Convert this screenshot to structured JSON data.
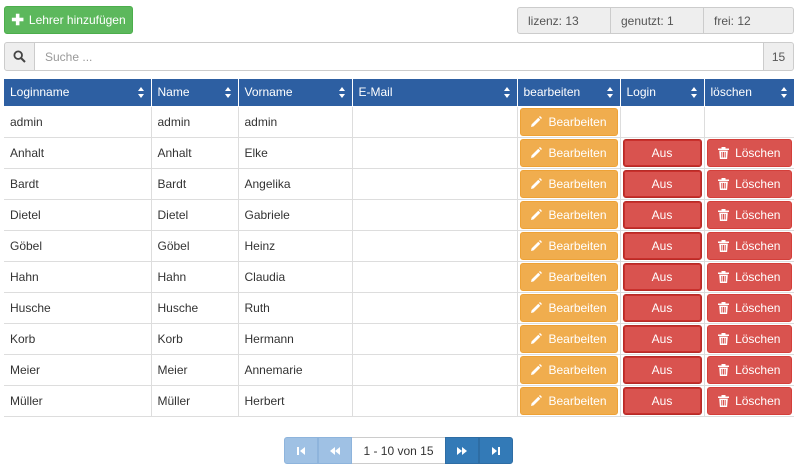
{
  "toolbar": {
    "add_label": "Lehrer hinzufügen"
  },
  "stats": {
    "lizenz": "lizenz: 13",
    "genutzt": "genutzt: 1",
    "frei": "frei: 12"
  },
  "search": {
    "placeholder": "Suche ...",
    "value": "",
    "count": "15"
  },
  "table": {
    "headers": [
      "Loginname",
      "Name",
      "Vorname",
      "E-Mail",
      "bearbeiten",
      "Login",
      "löschen"
    ],
    "edit_label": "Bearbeiten",
    "login_label": "Aus",
    "delete_label": "Löschen",
    "rows": [
      {
        "loginname": "admin",
        "name": "admin",
        "vorname": "admin",
        "email": ""
      },
      {
        "loginname": "Anhalt",
        "name": "Anhalt",
        "vorname": "Elke",
        "email": ""
      },
      {
        "loginname": "Bardt",
        "name": "Bardt",
        "vorname": "Angelika",
        "email": ""
      },
      {
        "loginname": "Dietel",
        "name": "Dietel",
        "vorname": "Gabriele",
        "email": ""
      },
      {
        "loginname": "Göbel",
        "name": "Göbel",
        "vorname": "Heinz",
        "email": ""
      },
      {
        "loginname": "Hahn",
        "name": "Hahn",
        "vorname": "Claudia",
        "email": ""
      },
      {
        "loginname": "Husche",
        "name": "Husche",
        "vorname": "Ruth",
        "email": ""
      },
      {
        "loginname": "Korb",
        "name": "Korb",
        "vorname": "Hermann",
        "email": ""
      },
      {
        "loginname": "Meier",
        "name": "Meier",
        "vorname": "Annemarie",
        "email": ""
      },
      {
        "loginname": "Müller",
        "name": "Müller",
        "vorname": "Herbert",
        "email": ""
      }
    ]
  },
  "pagination": {
    "info": "1 - 10 von 15"
  },
  "colors": {
    "header": "#2d5fa2",
    "success": "#5cb85c",
    "warning": "#f0ad4e",
    "danger": "#d9534f",
    "primary": "#337ab7"
  },
  "icons": {
    "add": "plus-icon",
    "search": "search-icon",
    "edit": "pencil-icon",
    "delete": "trash-icon"
  }
}
